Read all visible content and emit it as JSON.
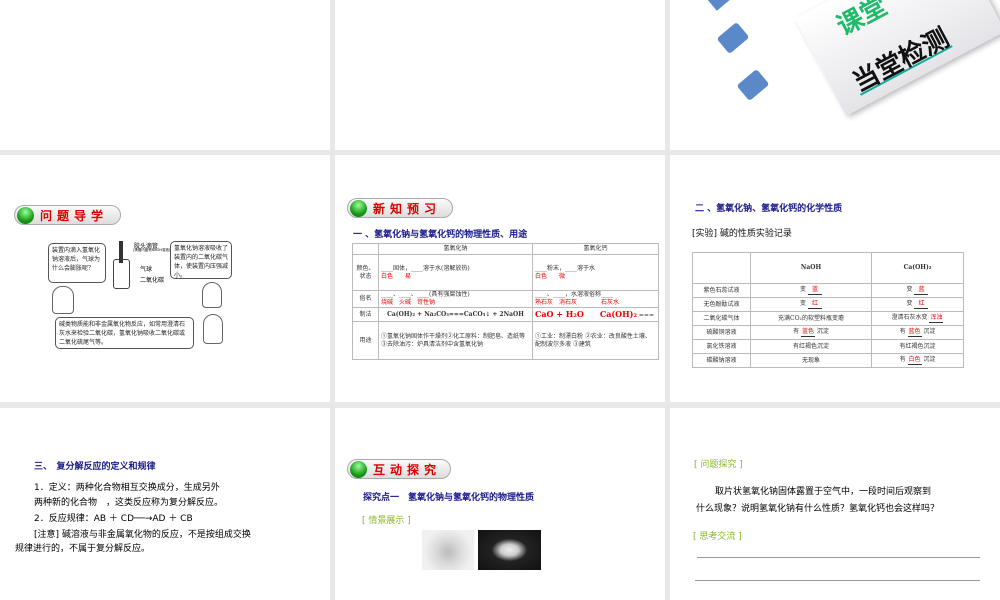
{
  "top_slide": {
    "title_partial": "课堂",
    "title": "当堂检测"
  },
  "slide_wenti": {
    "pill": "问题导学",
    "bubble1": "装置内滴入氢氧化钠溶液后，气球为什么会膨胀呢？",
    "bubble2": "氢氧化钠溶液吸收了装置内的二氧化碳气体，使装置内压强减小。",
    "bubble3": "碱类物质能和非金属氧化物反应，如常用澄清石灰水来检验二氧化碳，氢氧化钠吸收二氧化碳或二氧化硫尾气等。",
    "label_dropper": "胶头滴管",
    "label_dropper_note": "(滴管内盛有NaOH溶液)",
    "label_balloon": "气球",
    "label_co2": "二氧化碳"
  },
  "slide_xinzhi": {
    "pill": "新知预习",
    "heading": "一 、氢氧化钠与氢氧化钙的物理性质、用途",
    "headers": [
      "",
      "氢氧化钠",
      "氢氧化钙"
    ],
    "rows": [
      {
        "label": "颜色、状态",
        "naoh": "____固体，____溶于水(溶解放热)",
        "naoh_ans": "白色　　易",
        "caoh": "____粉末，____溶于水",
        "caoh_ans": "白色　　微"
      },
      {
        "label": "俗名",
        "naoh": "____、____、____(具有强腐蚀性)",
        "naoh_ans": "烧碱　火碱　苛性钠",
        "caoh": "____、____，水溶液俗称____",
        "caoh_ans": "熟石灰　消石灰　　　　石灰水"
      },
      {
        "label": "制法",
        "naoh": "Ca(OH)₂ + Na₂CO₃===CaCO₃↓ + 2NaOH",
        "caoh": "===",
        "caoh_ans": "CaO + H₂O　　Ca(OH)₂"
      },
      {
        "label": "用途",
        "naoh": "①氢氧化钠固体作干燥剂②化工原料：制肥皂、造纸等③去除油污：炉具清洁剂中含氢氧化钠",
        "caoh": "①工业：制漂白粉 ②农业：改良酸性土壤、配制波尔多液 ③建筑"
      }
    ]
  },
  "slide_huaxue": {
    "heading": "二 、氢氧化钠、氢氧化钙的化学性质",
    "subheading": "[实验] 碱的性质实验记录",
    "headers": [
      "",
      "NaOH",
      "Ca(OH)₂"
    ],
    "rows": [
      {
        "label": "紫色石蕊试液",
        "naoh_pre": "变",
        "naoh_ans": "蓝",
        "naoh_post": "",
        "caoh_pre": "变",
        "caoh_ans": "蓝",
        "caoh_post": ""
      },
      {
        "label": "无色酚酞试液",
        "naoh_pre": "变",
        "naoh_ans": "红",
        "naoh_post": "",
        "caoh_pre": "变",
        "caoh_ans": "红",
        "caoh_post": ""
      },
      {
        "label": "二氧化碳气体",
        "naoh_pre": "充满CO₂的软塑料瓶变瘪",
        "naoh_ans": "",
        "naoh_post": "",
        "caoh_pre": "澄清石灰水变",
        "caoh_ans": "浑浊",
        "caoh_post": ""
      },
      {
        "label": "硫酸铜溶液",
        "naoh_pre": "有",
        "naoh_ans": "蓝色",
        "naoh_post": "沉淀",
        "caoh_pre": "有",
        "caoh_ans": "蓝色",
        "caoh_post": "沉淀"
      },
      {
        "label": "氯化铁溶液",
        "naoh_pre": "有红褐色沉淀",
        "naoh_ans": "",
        "naoh_post": "",
        "caoh_pre": "有红褐色沉淀",
        "caoh_ans": "",
        "caoh_post": ""
      },
      {
        "label": "碳酸钠溶液",
        "naoh_pre": "无现象",
        "naoh_ans": "",
        "naoh_post": "",
        "caoh_pre": "有",
        "caoh_ans": "白色",
        "caoh_post": "沉淀"
      }
    ]
  },
  "slide_fufenjie": {
    "heading": "三、　复分解反应的定义和规律",
    "line1": "1．定义：两种化合物相互交换成分，生成另外",
    "line2": "两种新的化合物　，这类反应称为复分解反应。",
    "line3": "2．反应规律：AB ＋ CD──→AD ＋ CB",
    "line4": "[注意] 碱溶液与非金属氧化物的反应，不是按组成交换",
    "line5": "规律进行的，不属于复分解反应。"
  },
  "slide_hudong": {
    "pill": "互动探究",
    "heading": "探究点一　氢氧化钠与氢氧化钙的物理性质",
    "scene": "[ 情景展示 ]"
  },
  "slide_wentitanjiu": {
    "label1": "[ 问题探究 ]",
    "text1": "取片状氢氧化钠固体露置于空气中，一段时间后观察到",
    "text2": "什么现象？说明氢氧化钠有什么性质？氢氧化钙也会这样吗？",
    "label2": "[ 思考交流 ]"
  }
}
